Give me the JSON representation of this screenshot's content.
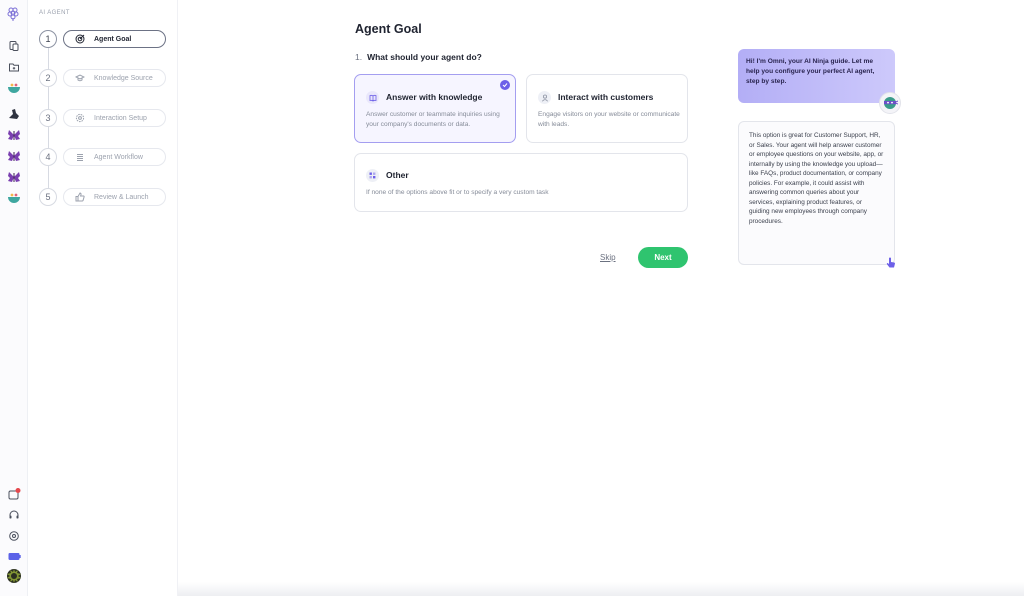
{
  "sidebar": {
    "section_label": "AI AGENT"
  },
  "steps": [
    {
      "num": "1",
      "label": "Agent Goal"
    },
    {
      "num": "2",
      "label": "Knowledge Source"
    },
    {
      "num": "3",
      "label": "Interaction Setup"
    },
    {
      "num": "4",
      "label": "Agent Workflow"
    },
    {
      "num": "5",
      "label": "Review & Launch"
    }
  ],
  "main": {
    "title": "Agent Goal",
    "question_num": "1.",
    "question": "What should your agent do?",
    "options": [
      {
        "title": "Answer with knowledge",
        "desc": "Answer customer or teammate inquiries using your company's documents or data."
      },
      {
        "title": "Interact with customers",
        "desc": "Engage visitors on your website or communicate with leads."
      },
      {
        "title": "Other",
        "desc": "If none of the options above fit or to specify a very custom task"
      }
    ],
    "skip_label": "Skip",
    "next_label": "Next"
  },
  "guide": {
    "intro": "Hi! I'm Omni, your AI Ninja guide. Let me help you configure your perfect AI agent, step by step.",
    "detail": "This option is great for Customer Support, HR, or Sales. Your agent will help answer customer or employee questions on your website, app, or internally by using the knowledge you upload—like FAQs, product documentation, or company policies. For example, it could assist with answering common queries about your services, explaining product features, or guiding new employees through company procedures."
  },
  "colors": {
    "accent": "#6d60e8",
    "next": "#2fc46f",
    "selected_border": "#a49ef0"
  }
}
